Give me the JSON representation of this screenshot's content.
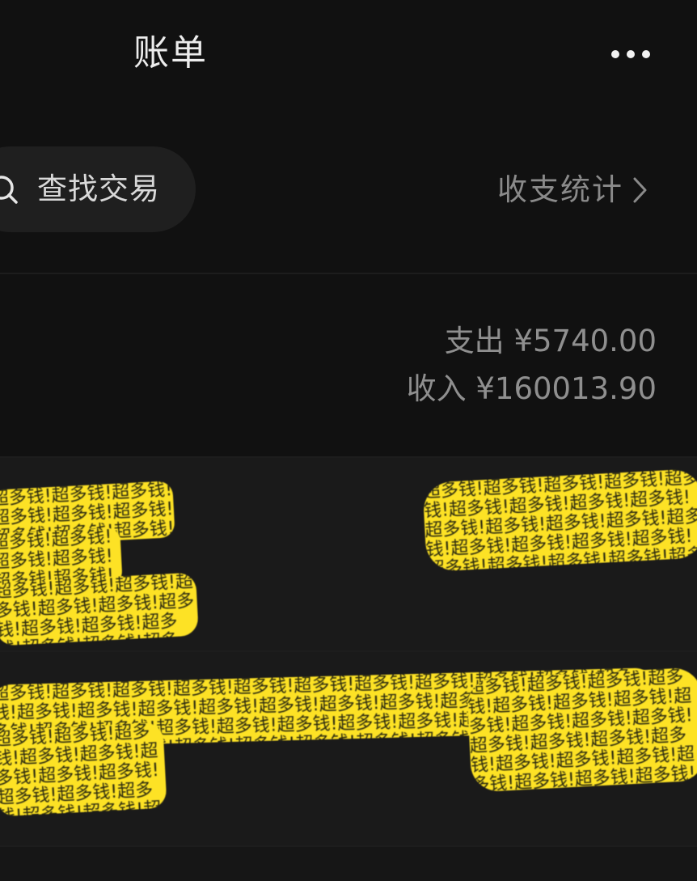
{
  "header": {
    "title": "账单"
  },
  "search": {
    "label": "查找交易"
  },
  "stats": {
    "label": "收支统计"
  },
  "summary": {
    "expense_label": "支出",
    "expense_value": "¥5740.00",
    "income_label": "收入",
    "income_value": "¥160013.90"
  },
  "redaction": {
    "pattern_text": "超多钱!超多钱!超多钱!超多钱!超多钱!超多钱!超多钱!超多钱!超多钱!超多钱!超多钱!超多钱!超多钱!超多钱!超多钱!超多钱!超多钱!超多钱!超多钱!超多钱!超多钱!超多钱!超多钱!超多钱!超多钱!超多钱!超多钱!超多钱!超多钱!超多钱!超多钱!超多钱!超多钱!超多钱!超多钱!超多钱!超多钱!超多钱!超多钱!超多钱!"
  },
  "colors": {
    "background": "#111111",
    "row_background": "#1a1a1a",
    "redaction_yellow": "#fde225",
    "title_text": "#ececec",
    "secondary_text": "#8f8f8f"
  }
}
